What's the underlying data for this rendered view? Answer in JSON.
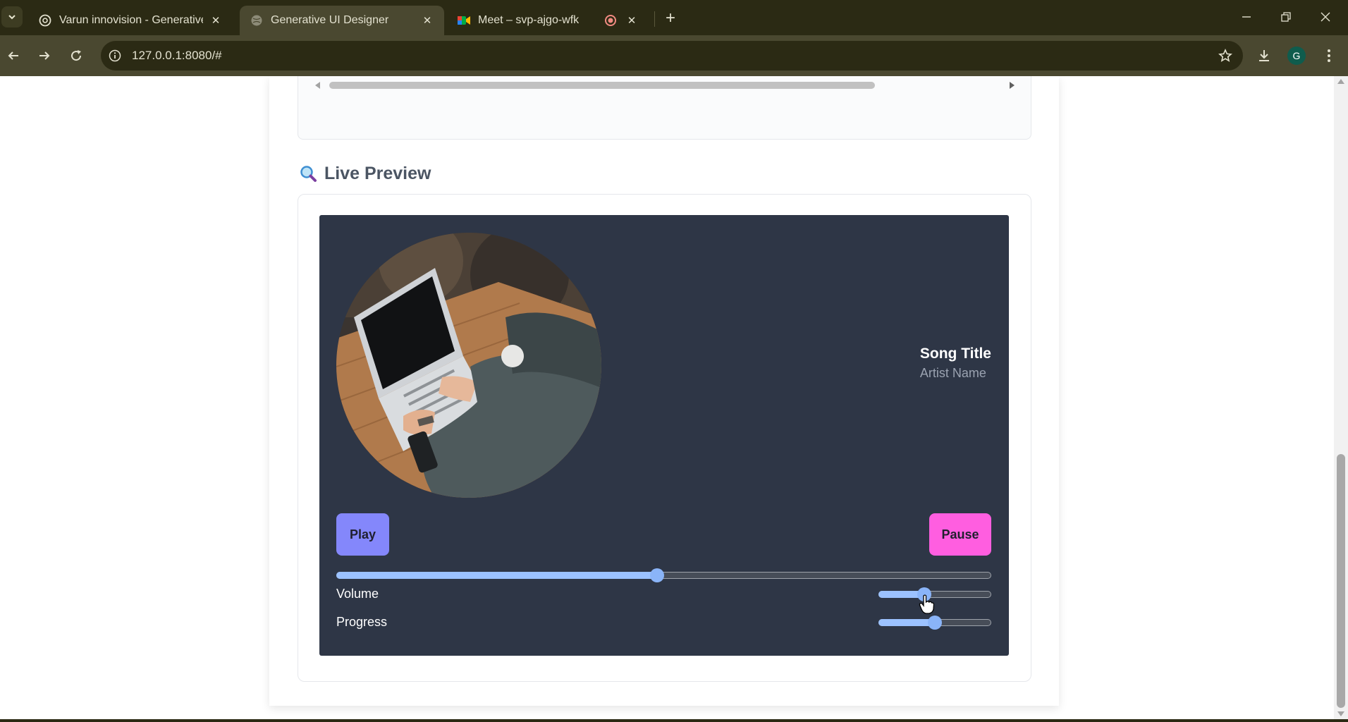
{
  "browser": {
    "tabs": [
      {
        "title": "Varun innovision - Generative A",
        "active": false
      },
      {
        "title": "Generative UI Designer",
        "active": true
      },
      {
        "title": "Meet – svp-ajgo-wfk",
        "active": false
      }
    ],
    "url": "127.0.0.1:8080/#",
    "profile_initial": "G"
  },
  "page": {
    "section_heading": "Live Preview",
    "player": {
      "song_title": "Song Title",
      "artist": "Artist Name",
      "play_label": "Play",
      "pause_label": "Pause",
      "seek_value_fraction": 0.49,
      "volume_label": "Volume",
      "volume_value_fraction": 0.39,
      "progress_label": "Progress",
      "progress_value_fraction": 0.5
    }
  },
  "colors": {
    "player_bg": "#2e3646",
    "play_button": "#8487fb",
    "pause_button": "#ff5ee0",
    "slider_accent": "#8ab4f8"
  }
}
